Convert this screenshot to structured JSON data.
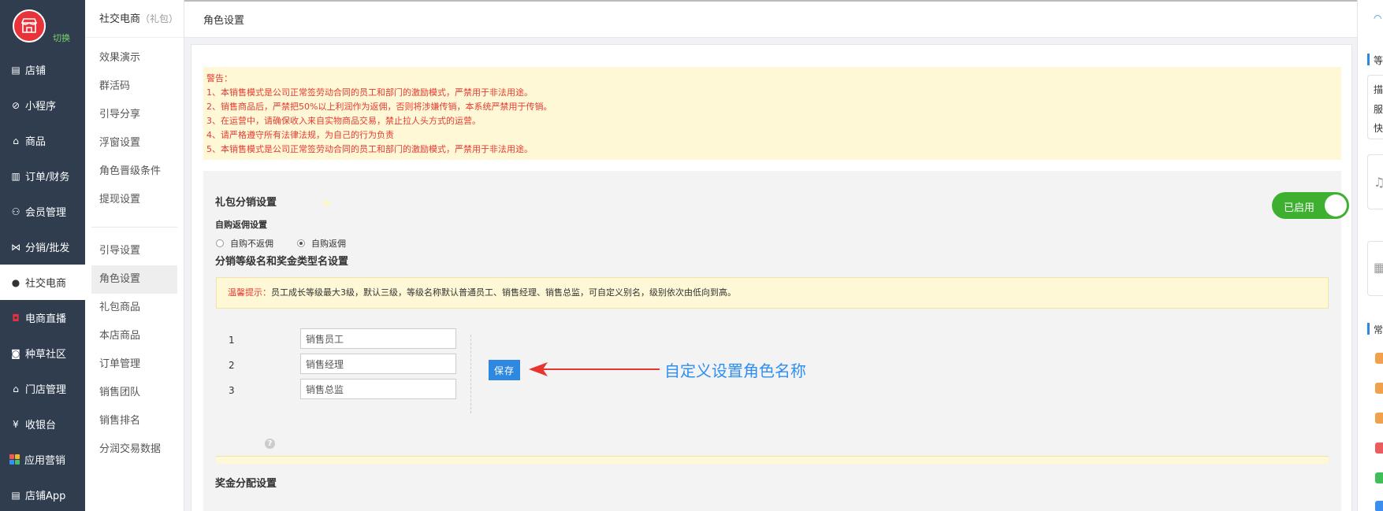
{
  "sidebar": {
    "switch_label": "切换",
    "items": [
      {
        "label": "店铺",
        "icon": "store-icon"
      },
      {
        "label": "小程序",
        "icon": "mini-program-icon"
      },
      {
        "label": "商品",
        "icon": "goods-icon"
      },
      {
        "label": "订单/财务",
        "icon": "order-icon"
      },
      {
        "label": "会员管理",
        "icon": "member-icon"
      },
      {
        "label": "分销/批发",
        "icon": "share-icon"
      },
      {
        "label": "社交电商",
        "icon": "wechat-icon"
      },
      {
        "label": "电商直播",
        "icon": "live-icon"
      },
      {
        "label": "种草社区",
        "icon": "community-icon"
      },
      {
        "label": "门店管理",
        "icon": "shop-icon"
      },
      {
        "label": "收银台",
        "icon": "cashier-icon"
      },
      {
        "label": "应用营销",
        "icon": "apps-icon"
      },
      {
        "label": "店铺App",
        "icon": "app-icon"
      }
    ]
  },
  "subnav": {
    "title": "社交电商",
    "title_suffix": "（礼包）",
    "group1": [
      "效果演示",
      "群活码",
      "引导分享",
      "浮窗设置",
      "角色晋级条件",
      "提现设置"
    ],
    "group2": [
      "引导设置",
      "角色设置",
      "礼包商品",
      "本店商品",
      "订单管理",
      "销售团队",
      "销售排名",
      "分润交易数据"
    ]
  },
  "header": {
    "title": "角色设置"
  },
  "warning": {
    "heading": "警告：",
    "lines": [
      "1、本销售模式是公司正常签劳动合同的员工和部门的激励模式，严禁用于非法用途。",
      "2、销售商品后，严禁把50%以上利润作为返佣，否则将涉嫌传销，本系统严禁用于传销。",
      "3、在运营中，请确保收入来自实物商品交易，禁止拉人头方式的运营。",
      "4、请严格遵守所有法律法规，为自己的行为负责",
      "5、本销售模式是公司正常签劳动合同的员工和部门的激励模式，严禁用于非法用途。"
    ]
  },
  "gift": {
    "title": "礼包分销设置",
    "toggle_label": "已启用",
    "self_title": "自购返佣设置",
    "opt_no": "自购不返佣",
    "opt_yes": "自购返佣",
    "level_title": "分销等级名和奖金类型名设置",
    "tip_prefix": "温馨提示：",
    "tip_text": "员工成长等级最大3级，默认三级，等级名称默认普通员工、销售经理、销售总监，可自定义别名，级别依次由低向到高。",
    "levels": [
      {
        "num": "1",
        "name": "销售员工"
      },
      {
        "num": "2",
        "name": "销售经理"
      },
      {
        "num": "3",
        "name": "销售总监"
      }
    ],
    "save_label": "保存",
    "annotation": "自定义设置角色名称",
    "bonus_title": "奖金分配设置",
    "help_glyph": "?"
  },
  "right": {
    "chars": [
      "等",
      "描",
      "服",
      "快",
      "常"
    ]
  },
  "colors": {
    "sidebar_bg": "#2f3d4f",
    "accent_blue": "#2f88e0",
    "toggle_green": "#3db02f",
    "warn_red": "#e53b32",
    "warn_bg": "#fff8d6"
  }
}
